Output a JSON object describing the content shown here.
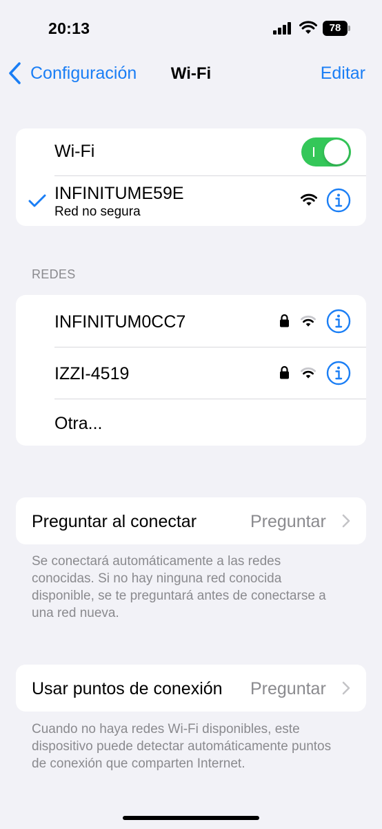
{
  "status_bar": {
    "time": "20:13",
    "battery": "78"
  },
  "nav": {
    "back_label": "Configuración",
    "title": "Wi-Fi",
    "edit_label": "Editar"
  },
  "wifi_card": {
    "toggle_label": "Wi-Fi",
    "toggle_on": true,
    "connected_network": {
      "name": "INFINITUME59E",
      "status": "Red no segura"
    }
  },
  "networks_section": {
    "header": "REDES",
    "items": [
      {
        "name": "INFINITUM0CC7",
        "locked": true
      },
      {
        "name": "IZZI-4519",
        "locked": true
      }
    ],
    "other_label": "Otra..."
  },
  "ask_join": {
    "label": "Preguntar al conectar",
    "value": "Preguntar",
    "footnote": "Se conectará automáticamente a las redes conocidas. Si no hay ninguna red conocida disponible, se te preguntará antes de conectarse a una red nueva."
  },
  "hotspot": {
    "label": "Usar puntos de conexión",
    "value": "Preguntar",
    "footnote": "Cuando no haya redes Wi-Fi disponibles, este dispositivo puede detectar automáticamente puntos de conexión que comparten Internet."
  },
  "colors": {
    "accent": "#1a7ef5",
    "toggle_on": "#34c759",
    "background": "#f2f2f7",
    "secondary_text": "#8a8a8e"
  }
}
